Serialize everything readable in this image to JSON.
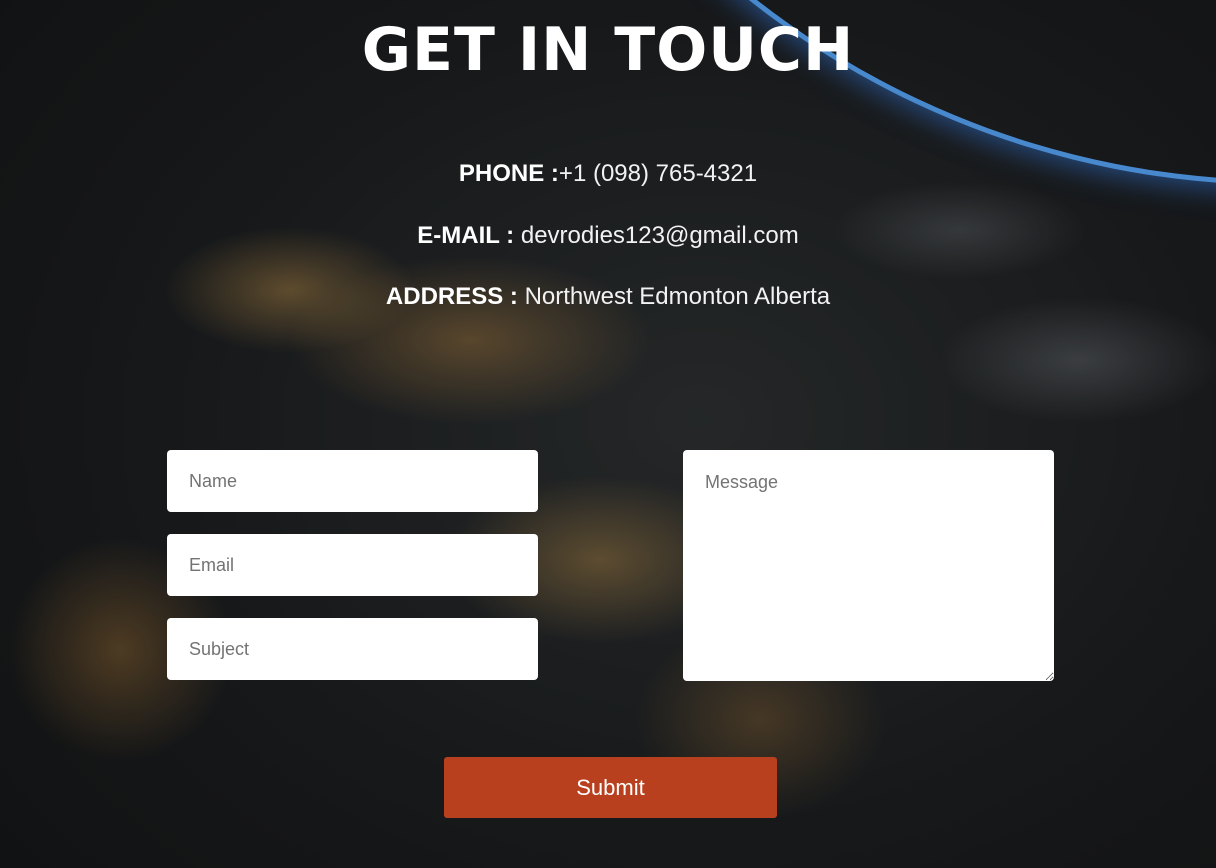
{
  "page": {
    "title": "GET IN TOUCH"
  },
  "contact": {
    "phone_label": "PHONE :",
    "phone_value": "+1 (098) 765-4321",
    "email_label": "E-MAIL :",
    "email_value": " devrodies123@gmail.com",
    "address_label": "ADDRESS :",
    "address_value": " Northwest Edmonton Alberta"
  },
  "form": {
    "name_placeholder": "Name",
    "email_placeholder": "Email",
    "subject_placeholder": "Subject",
    "message_placeholder": "Message",
    "submit_label": "Submit"
  },
  "colors": {
    "submit_button": "#b9401e",
    "text": "#ffffff",
    "background": "#141516",
    "atmosphere": "#5aaaff"
  }
}
